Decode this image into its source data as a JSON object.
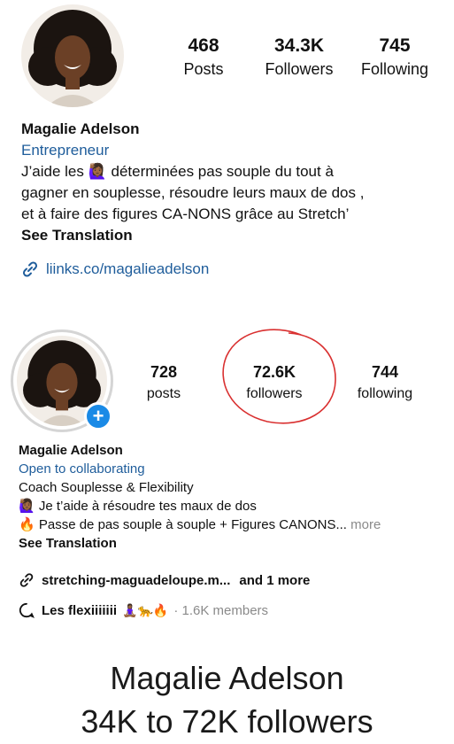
{
  "before": {
    "stats": [
      {
        "value": "468",
        "label": "Posts"
      },
      {
        "value": "34.3K",
        "label": "Followers"
      },
      {
        "value": "745",
        "label": "Following"
      }
    ],
    "name": "Magalie Adelson",
    "category": "Entrepreneur",
    "bio_line1_a": "J’aide les",
    "bio_line1_b": "déterminées pas souple du tout à",
    "bio_line2": "gagner en souplesse, résoudre leurs maux de dos ,",
    "bio_line3": "et à faire des figures CA-NONS grâce au Stretch’",
    "see_translation": "See Translation",
    "link": "liinks.co/magalieadelson"
  },
  "after": {
    "stats": [
      {
        "value": "728",
        "label": "posts"
      },
      {
        "value": "72.6K",
        "label": "followers"
      },
      {
        "value": "744",
        "label": "following"
      }
    ],
    "name": "Magalie Adelson",
    "category": "Open to collaborating",
    "bio_line1": "Coach Souplesse & Flexibility",
    "bio_line2": "Je t’aide à résoudre tes maux de dos",
    "bio_line3": "Passe de pas souple à souple + Figures CANONS...",
    "more": "more",
    "see_translation": "See Translation",
    "link": "stretching-maguadeloupe.m...",
    "link_more": "and 1 more",
    "community_name": "Les flexiiiiiii",
    "community_emojis": "🧘🏾‍♀️🐆🔥",
    "community_members": "· 1.6K members"
  },
  "caption": {
    "line1": "Magalie Adelson",
    "line2": "34K to 72K followers"
  },
  "colors": {
    "link_blue": "#1f5d9b",
    "badge_blue": "#1a8ae6",
    "highlight_red": "#d93030"
  },
  "icons": [
    "link-icon",
    "threads-icon",
    "plus-icon"
  ]
}
